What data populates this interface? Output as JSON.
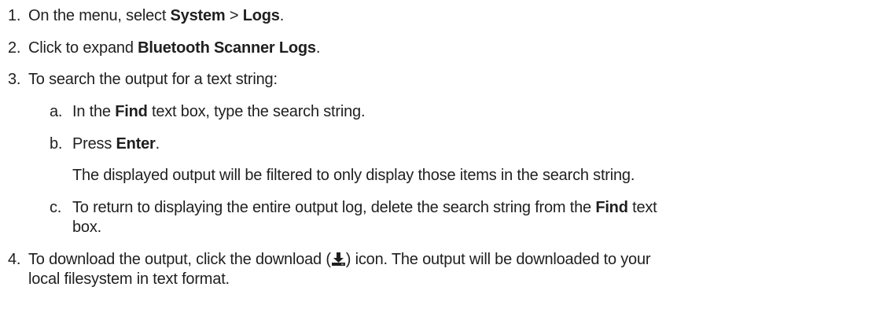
{
  "steps": [
    {
      "number": "1.",
      "pre": "On the menu, select ",
      "b1": "System",
      "mid": " > ",
      "b2": "Logs",
      "post": "."
    },
    {
      "number": "2.",
      "pre": "Click to expand ",
      "b1": "Bluetooth Scanner Logs",
      "post": "."
    },
    {
      "number": "3.",
      "text": "To search the output for a text string:",
      "substeps": [
        {
          "letter": "a.",
          "pre": "In the ",
          "b1": "Find",
          "post": " text box, type the search string."
        },
        {
          "letter": "b.",
          "pre": "Press ",
          "b1": "Enter",
          "post": ".",
          "note": "The displayed output will be filtered to only display those items in the search string."
        },
        {
          "letter": "c.",
          "pre": "To return to displaying the entire output log, delete the search string from the ",
          "b1": "Find",
          "post": " text",
          "cont": "box."
        }
      ]
    },
    {
      "number": "4.",
      "pre": "To download the output, click the download (",
      "icon": "download-icon",
      "post": ") icon. The output will be downloaded to your",
      "cont": "local filesystem in text format."
    }
  ]
}
